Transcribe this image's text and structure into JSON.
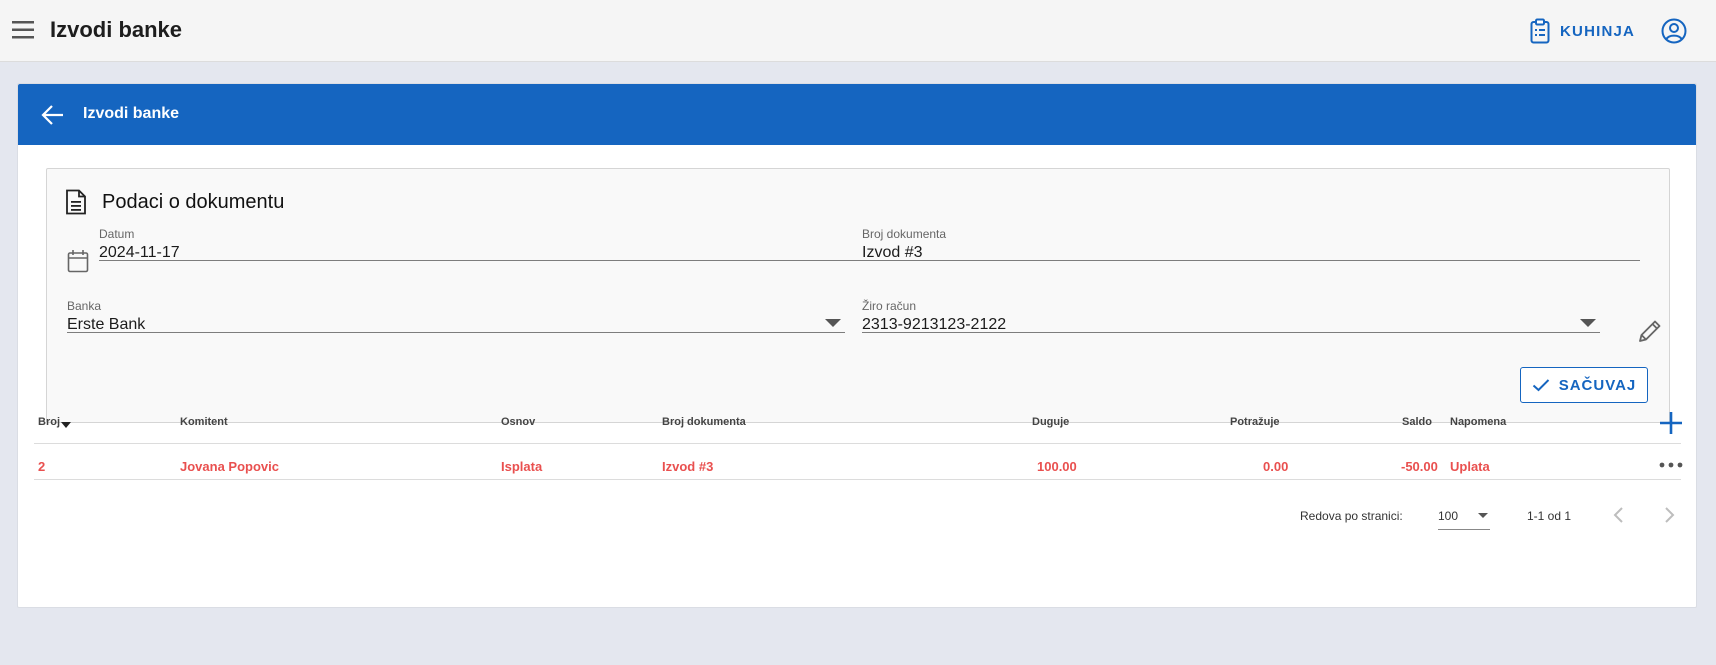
{
  "topbar": {
    "title": "Izvodi banke",
    "kuhinja_label": "KUHINJA"
  },
  "card": {
    "header_title": "Izvodi banke"
  },
  "panel": {
    "title": "Podaci o dokumentu",
    "datum": {
      "label": "Datum",
      "value": "2024-11-17"
    },
    "broj_dokumenta": {
      "label": "Broj dokumenta",
      "value": "Izvod #3"
    },
    "banka": {
      "label": "Banka",
      "value": "Erste Bank"
    },
    "ziro_racun": {
      "label": "Žiro račun",
      "value": "2313-9213123-2122"
    },
    "save_label": "SAČUVAJ"
  },
  "table": {
    "headers": {
      "broj": "Broj",
      "komitent": "Komitent",
      "osnov": "Osnov",
      "broj_dokumenta": "Broj dokumenta",
      "duguje": "Duguje",
      "potrazuje": "Potražuje",
      "saldo": "Saldo",
      "napomena": "Napomena"
    },
    "rows": [
      {
        "broj": "2",
        "komitent": "Jovana Popovic",
        "osnov": "Isplata",
        "broj_dokumenta": "Izvod #3",
        "duguje": "100.00",
        "potrazuje": "0.00",
        "saldo": "-50.00",
        "napomena": "Uplata"
      }
    ],
    "row_color": "#e9504f"
  },
  "pagination": {
    "rows_per_page_label": "Redova po stranici:",
    "rows_per_page_value": "100",
    "range": "1-1 od 1"
  },
  "colors": {
    "accent": "#1565c0",
    "negative": "#e9504f"
  }
}
